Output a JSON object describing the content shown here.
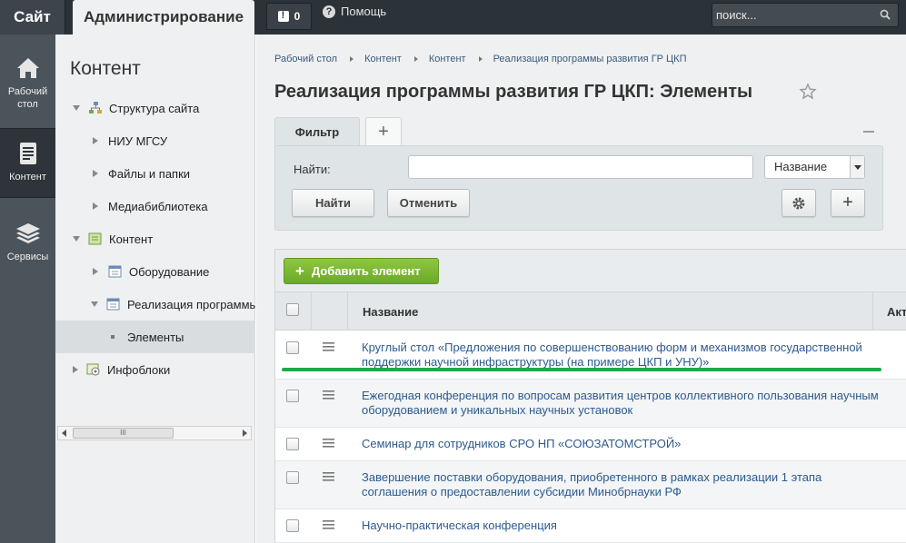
{
  "topbar": {
    "site_tab": "Сайт",
    "admin_tab": "Администрирование",
    "notifications_count": "0",
    "help_label": "Помощь",
    "search_placeholder": "поиск..."
  },
  "rail": {
    "items": [
      {
        "label_line1": "Рабочий",
        "label_line2": "стол",
        "icon": "home-icon"
      },
      {
        "label_line1": "Контент",
        "icon": "document-icon",
        "active": true
      },
      {
        "label_line1": "Сервисы",
        "icon": "layers-icon"
      }
    ]
  },
  "sidebar": {
    "title": "Контент",
    "items": [
      {
        "label": "Структура сайта"
      },
      {
        "label": "НИУ МГСУ"
      },
      {
        "label": "Файлы и папки"
      },
      {
        "label": "Медиабиблиотека"
      },
      {
        "label": "Контент"
      },
      {
        "label": "Оборудование"
      },
      {
        "label": "Реализация программы"
      },
      {
        "label": "Элементы"
      },
      {
        "label": "Инфоблоки"
      }
    ],
    "scroll_thumb_label": "III"
  },
  "breadcrumb": [
    "Рабочий стол",
    "Контент",
    "Контент",
    "Реализация программы развития ГР ЦКП"
  ],
  "page_title": "Реализация программы развития ГР ЦКП: Элементы",
  "filter": {
    "tab_label": "Фильтр",
    "add_tab_label": "+",
    "find_label": "Найти:",
    "find_value": "",
    "select_value": "Название",
    "find_button": "Найти",
    "cancel_button": "Отменить",
    "add_button": "+"
  },
  "table": {
    "add_element_label": "Добавить элемент",
    "header_name": "Название",
    "header_active": "Акт",
    "rows": [
      {
        "name": "Круглый стол «Предложения по совершенствованию форм и механизмов государственной поддержки научной инфраструктуры (на примере ЦКП и УНУ)»"
      },
      {
        "name": "Ежегодная конференция по вопросам развития центров коллективного пользования научным оборудованием и уникальных научных установок"
      },
      {
        "name": "Семинар для сотрудников СРО НП «СОЮЗАТОМСТРОЙ»"
      },
      {
        "name": "Завершение поставки оборудования, приобретенного в рамках реализации 1 этапа соглашения о предоставлении субсидии Минобрнауки РФ"
      },
      {
        "name": "Научно-практическая конференция"
      }
    ]
  },
  "colors": {
    "topbar": "#2b3238",
    "rail": "#4c545b",
    "link": "#2d5a8e",
    "add_button": "#7ab534",
    "highlight_line": "#1faa4a"
  }
}
